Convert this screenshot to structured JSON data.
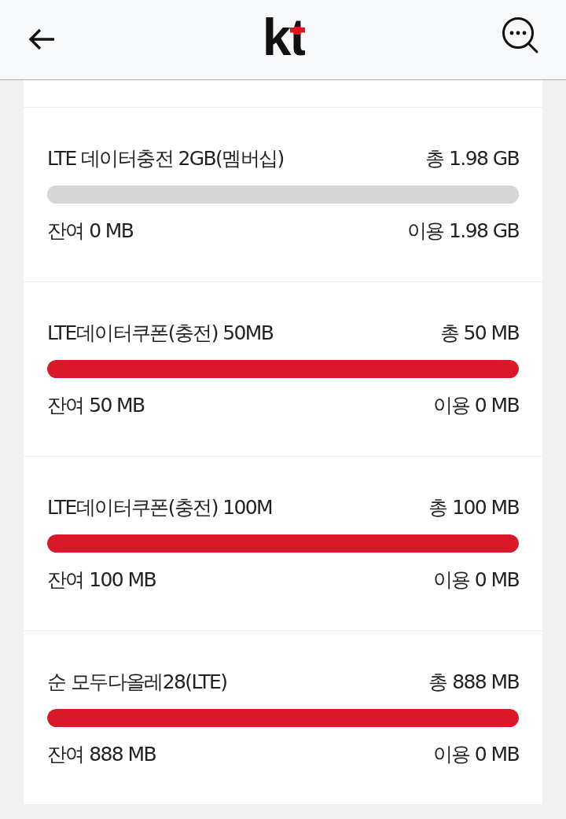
{
  "header": {
    "logo": "kt"
  },
  "plans": [
    {
      "title": "LTE 데이터충전 2GB(멤버십)",
      "total": "총 1.98 GB",
      "remaining": "잔여 0 MB",
      "used": "이용 1.98 GB",
      "level": 0
    },
    {
      "title": "LTE데이터쿠폰(충전) 50MB",
      "total": "총 50 MB",
      "remaining": "잔여 50 MB",
      "used": "이용 0 MB",
      "level": 1
    },
    {
      "title": "LTE데이터쿠폰(충전) 100M",
      "total": "총 100 MB",
      "remaining": "잔여 100 MB",
      "used": "이용 0 MB",
      "level": 1
    },
    {
      "title": "순 모두다올레28(LTE)",
      "total": "총 888 MB",
      "remaining": "잔여 888 MB",
      "used": "이용 0 MB",
      "level": 1
    }
  ]
}
